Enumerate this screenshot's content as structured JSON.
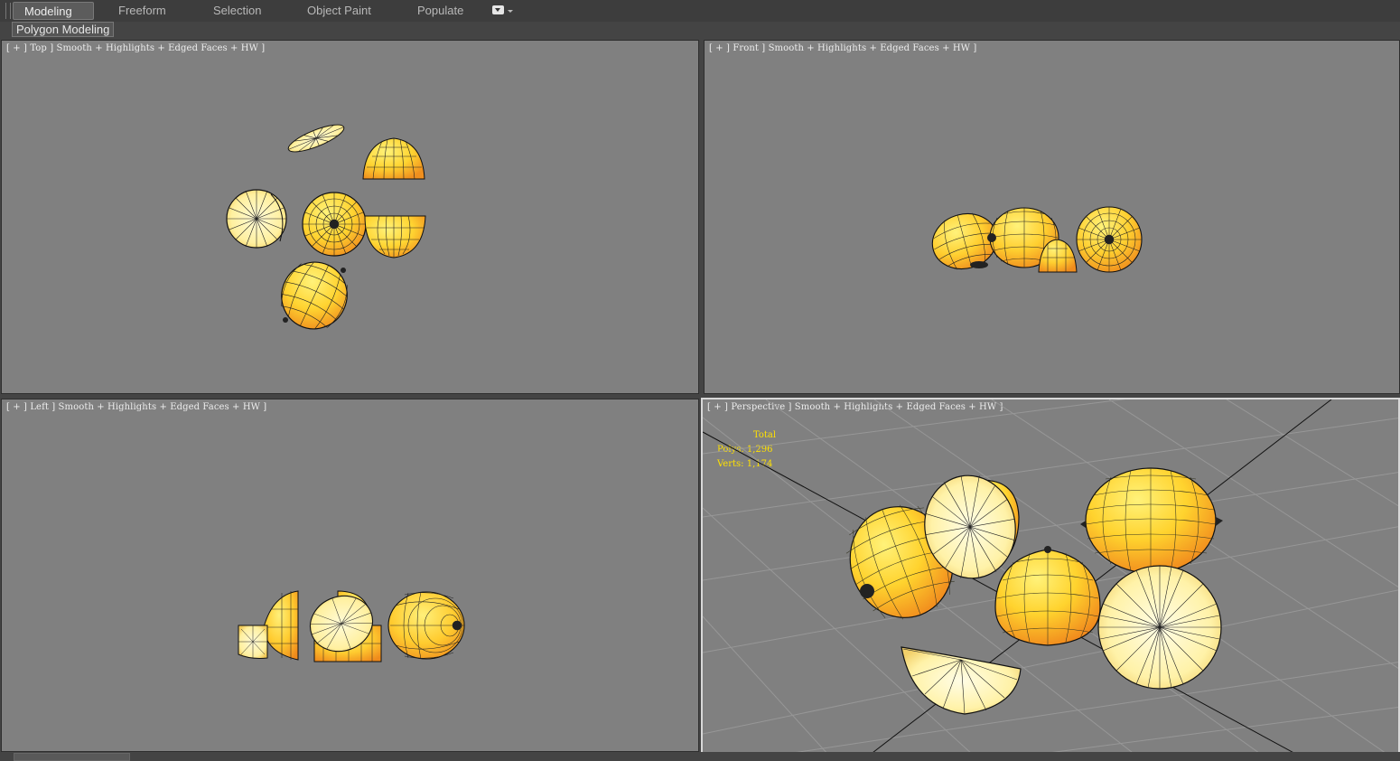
{
  "ribbon": {
    "tabs": [
      "Modeling",
      "Freeform",
      "Selection",
      "Object Paint",
      "Populate"
    ],
    "active_tab": "Modeling",
    "sub_tab": "Polygon Modeling"
  },
  "viewports": {
    "top": {
      "label": "[ + ] Top ] Smooth + Highlights + Edged Faces + HW ]"
    },
    "front": {
      "label": "[ + ] Front ] Smooth + Highlights + Edged Faces + HW ]"
    },
    "left": {
      "label": "[ + ] Left ] Smooth + Highlights + Edged Faces + HW ]"
    },
    "perspective": {
      "label": "[ + ] Perspective ] Smooth + Highlights + Edged Faces + HW ]"
    }
  },
  "stats": {
    "title": "Total",
    "polys_label": "Polys:",
    "polys_value": "1,296",
    "verts_label": "Verts:",
    "verts_value": "1,174"
  },
  "colors": {
    "viewport_bg": "#808080",
    "lemon_light": "#ffe34a",
    "lemon_dark": "#f39a1e",
    "pulp": "#fff6b0",
    "stats_text": "#ffe100"
  }
}
